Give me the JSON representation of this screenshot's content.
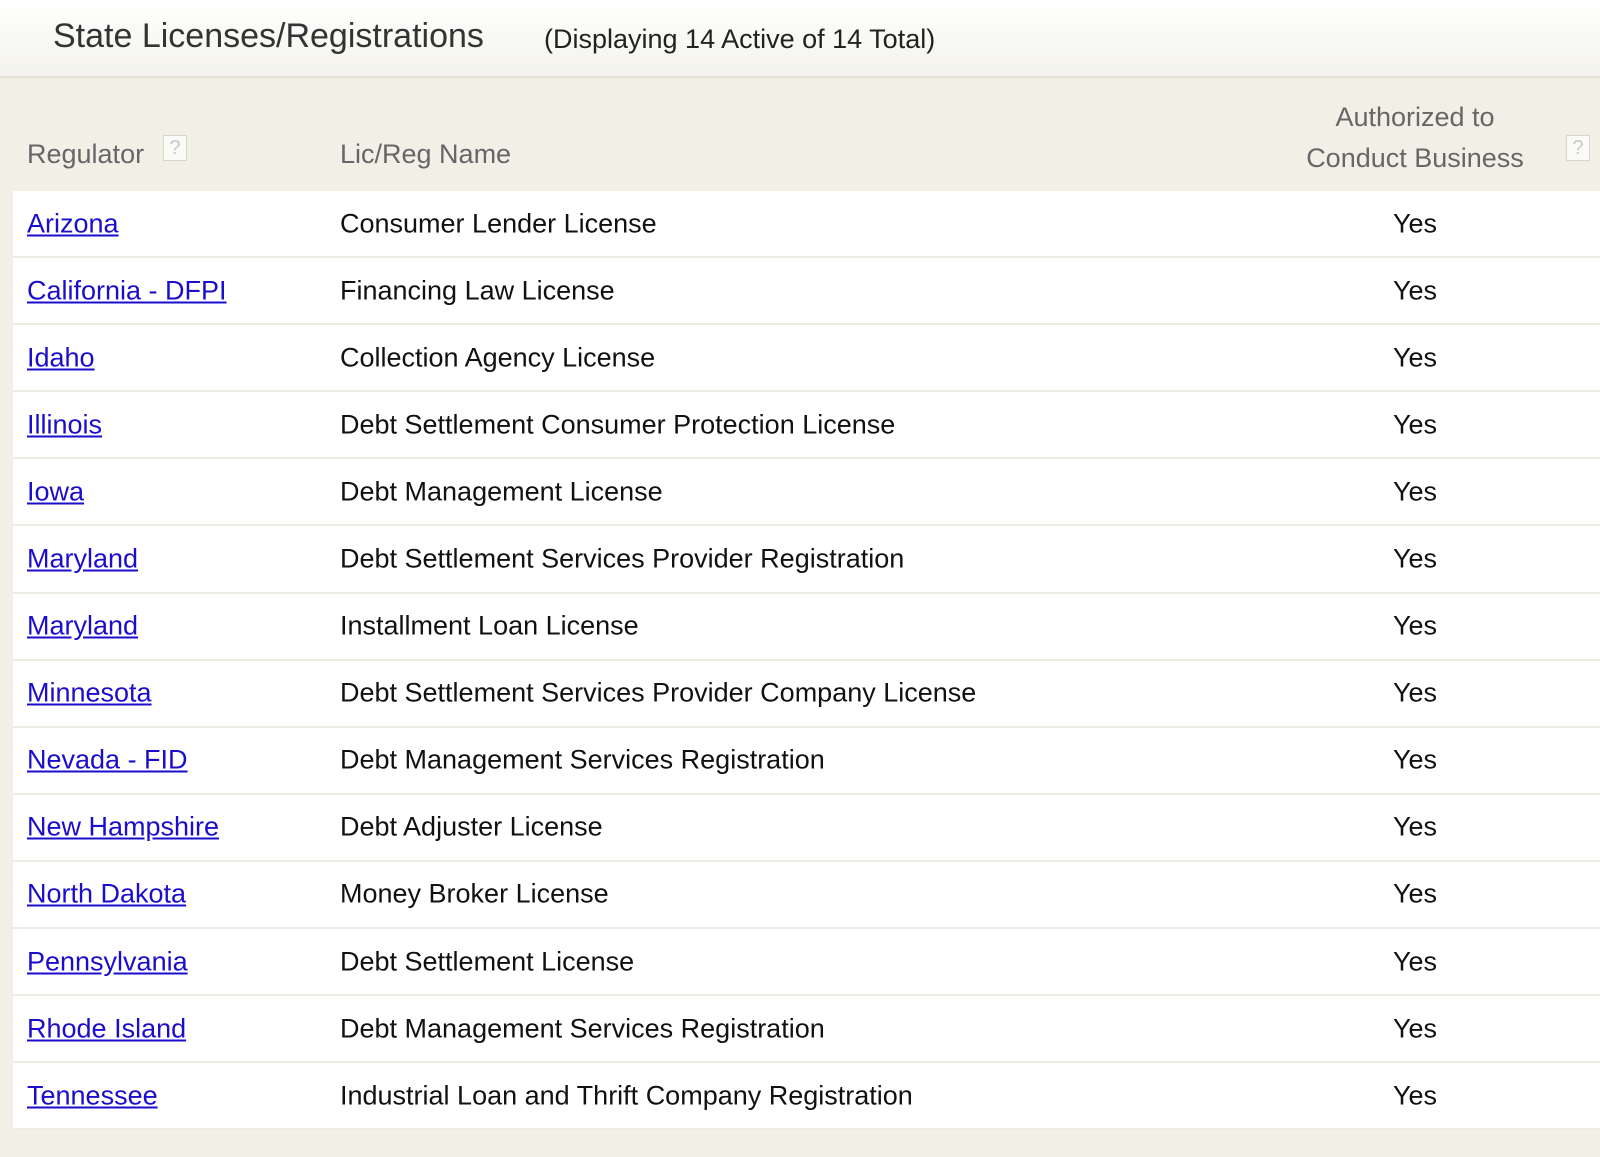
{
  "header": {
    "title": "State Licenses/Registrations",
    "subtitle": "(Displaying 14 Active of 14 Total)"
  },
  "table": {
    "columns": {
      "regulator": "Regulator",
      "name": "Lic/Reg Name",
      "auth_line1": "Authorized to",
      "auth_line2": "Conduct Business",
      "help_glyph": "?"
    },
    "rows": [
      {
        "regulator": "Arizona",
        "name": "Consumer Lender License",
        "authorized": "Yes"
      },
      {
        "regulator": "California - DFPI",
        "name": "Financing Law License",
        "authorized": "Yes"
      },
      {
        "regulator": "Idaho",
        "name": "Collection Agency License",
        "authorized": "Yes"
      },
      {
        "regulator": "Illinois",
        "name": "Debt Settlement Consumer Protection License",
        "authorized": "Yes"
      },
      {
        "regulator": "Iowa",
        "name": "Debt Management License",
        "authorized": "Yes"
      },
      {
        "regulator": "Maryland",
        "name": "Debt Settlement Services Provider Registration",
        "authorized": "Yes"
      },
      {
        "regulator": "Maryland",
        "name": "Installment Loan License",
        "authorized": "Yes"
      },
      {
        "regulator": "Minnesota",
        "name": "Debt Settlement Services Provider Company License",
        "authorized": "Yes"
      },
      {
        "regulator": "Nevada - FID",
        "name": "Debt Management Services Registration",
        "authorized": "Yes"
      },
      {
        "regulator": "New Hampshire",
        "name": "Debt Adjuster License",
        "authorized": "Yes"
      },
      {
        "regulator": "North Dakota",
        "name": "Money Broker License",
        "authorized": "Yes"
      },
      {
        "regulator": "Pennsylvania",
        "name": "Debt Settlement License",
        "authorized": "Yes"
      },
      {
        "regulator": "Rhode Island",
        "name": "Debt Management Services Registration",
        "authorized": "Yes"
      },
      {
        "regulator": "Tennessee",
        "name": "Industrial Loan and Thrift Company Registration",
        "authorized": "Yes"
      }
    ]
  },
  "colors": {
    "link": "#1a0dcc",
    "header_bg": "#f2f0e6"
  }
}
